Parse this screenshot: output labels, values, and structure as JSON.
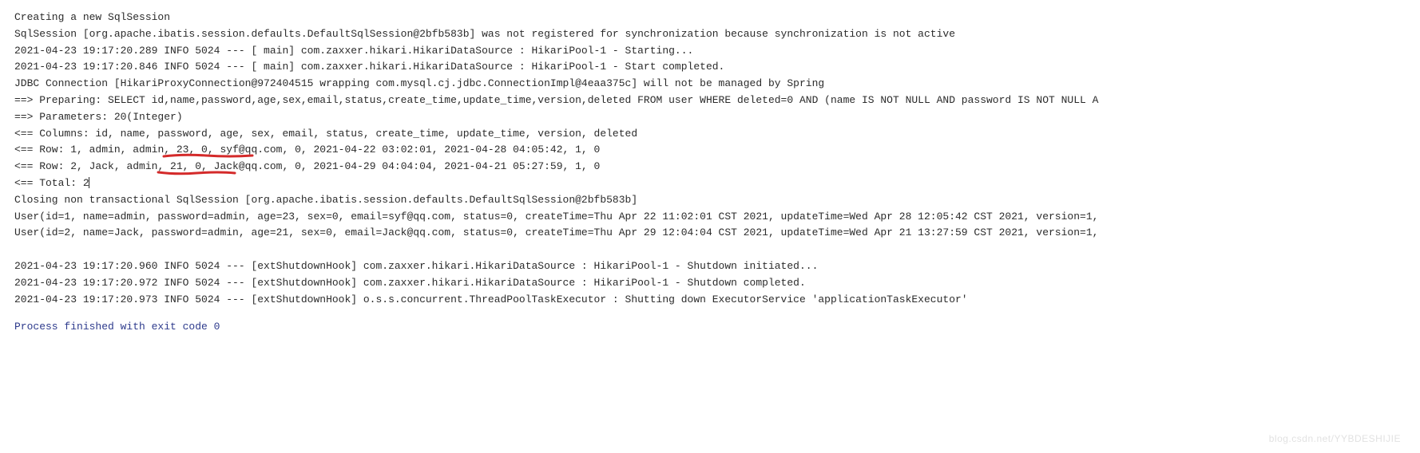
{
  "lines": {
    "l0": "Creating a new SqlSession",
    "l1": "SqlSession [org.apache.ibatis.session.defaults.DefaultSqlSession@2bfb583b] was not registered for synchronization because synchronization is not active",
    "l2": "2021-04-23 19:17:20.289  INFO 5024 --- [           main] com.zaxxer.hikari.HikariDataSource       : HikariPool-1 - Starting...",
    "l3": "2021-04-23 19:17:20.846  INFO 5024 --- [           main] com.zaxxer.hikari.HikariDataSource       : HikariPool-1 - Start completed.",
    "l4": "JDBC Connection [HikariProxyConnection@972404515 wrapping com.mysql.cj.jdbc.ConnectionImpl@4eaa375c] will not be managed by Spring",
    "l5": "==>  Preparing: SELECT id,name,password,age,sex,email,status,create_time,update_time,version,deleted FROM user WHERE deleted=0 AND (name IS NOT NULL AND password IS NOT NULL A",
    "l6": "==> Parameters: 20(Integer)",
    "l7": "<==    Columns: id, name, password, age, sex, email, status, create_time, update_time, version, deleted",
    "l8_pre": "<==        Row: 1, admin, ",
    "l8_hl": "admin, 23, 0",
    "l8_post": ", syf@qq.com, 0, 2021-04-22 03:02:01, 2021-04-28 04:05:42, 1, 0",
    "l9_pre": "<==        Row: 2, Jack, ",
    "l9_hl": "admin, 21,",
    "l9_post": " 0, Jack@qq.com, 0, 2021-04-29 04:04:04, 2021-04-21 05:27:59, 1, 0",
    "l10": "<==      Total: 2",
    "l11": "Closing non transactional SqlSession [org.apache.ibatis.session.defaults.DefaultSqlSession@2bfb583b]",
    "l12": "User(id=1, name=admin, password=admin, age=23, sex=0, email=syf@qq.com, status=0, createTime=Thu Apr 22 11:02:01 CST 2021, updateTime=Wed Apr 28 12:05:42 CST 2021, version=1,",
    "l13": "User(id=2, name=Jack, password=admin, age=21, sex=0, email=Jack@qq.com, status=0, createTime=Thu Apr 29 12:04:04 CST 2021, updateTime=Wed Apr 21 13:27:59 CST 2021, version=1,",
    "l14": "2021-04-23 19:17:20.960  INFO 5024 --- [extShutdownHook] com.zaxxer.hikari.HikariDataSource       : HikariPool-1 - Shutdown initiated...",
    "l15": "2021-04-23 19:17:20.972  INFO 5024 --- [extShutdownHook] com.zaxxer.hikari.HikariDataSource       : HikariPool-1 - Shutdown completed.",
    "l16": "2021-04-23 19:17:20.973  INFO 5024 --- [extShutdownHook] o.s.s.concurrent.ThreadPoolTaskExecutor  : Shutting down ExecutorService 'applicationTaskExecutor'",
    "exit": "Process finished with exit code 0"
  },
  "watermark": "blog.csdn.net/YYBDESHIJIE"
}
